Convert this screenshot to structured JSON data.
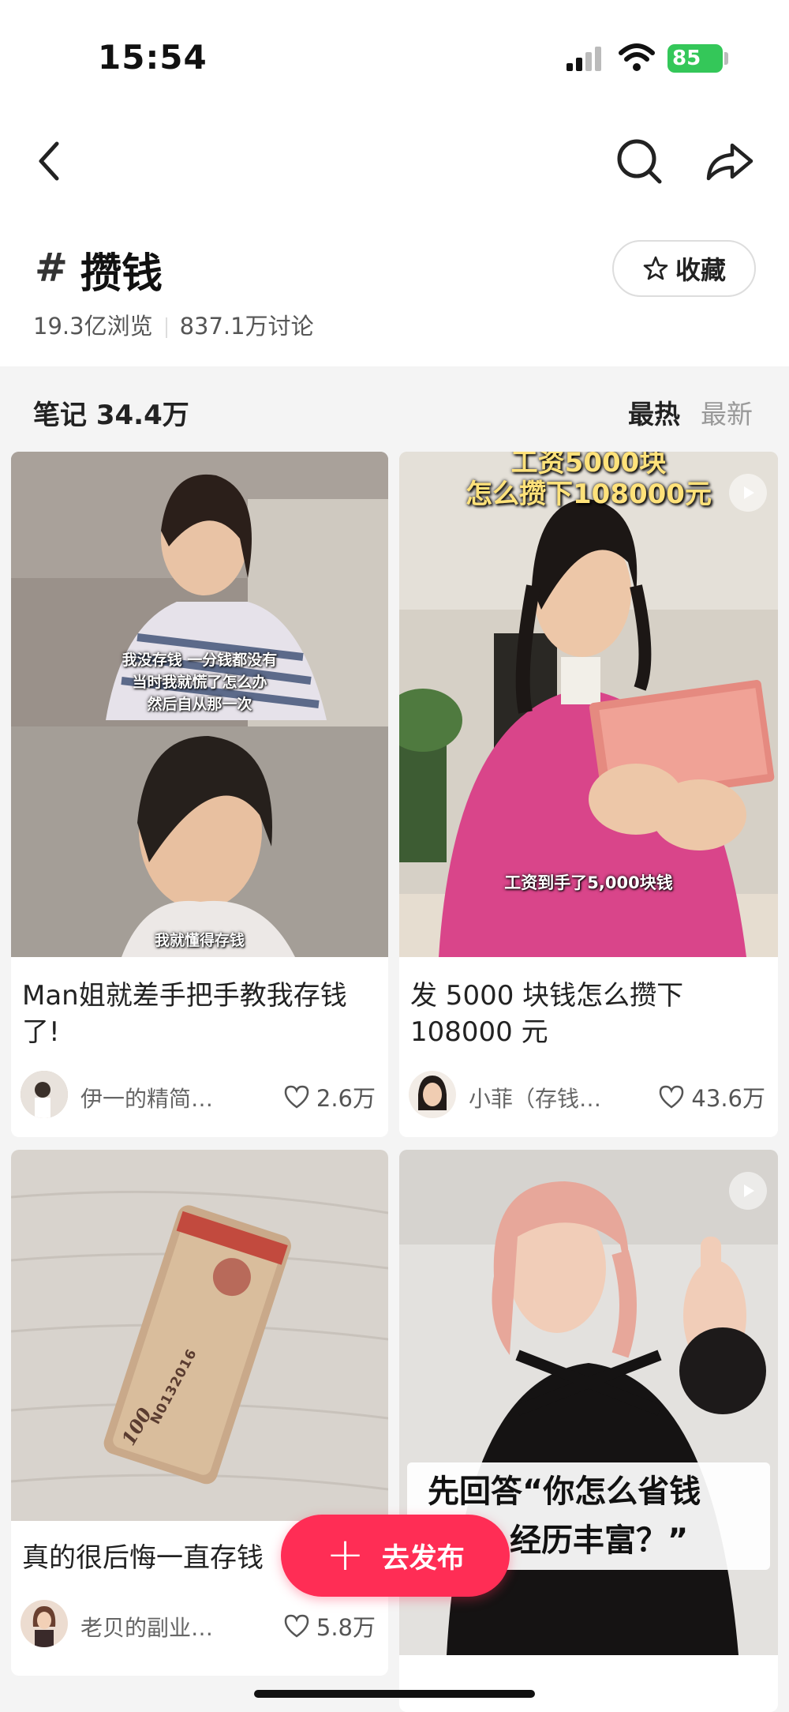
{
  "status_bar": {
    "time": "15:54",
    "battery": "85"
  },
  "topic": {
    "hash": "#",
    "title": "攒钱",
    "views": "19.3亿浏览",
    "discussions": "837.1万讨论",
    "favorite_label": "收藏"
  },
  "notes": {
    "count_label": "笔记 34.4万",
    "sort_hot": "最热",
    "sort_new": "最新"
  },
  "cards": [
    {
      "title": "Man姐就差手把手教我存钱了!",
      "author": "伊一的精简…",
      "likes": "2.6万",
      "subtitle_lines": [
        "我没存钱 一分钱都没有",
        "当时我就慌了怎么办",
        "然后自从那一次"
      ],
      "subtitle_bottom": "我就懂得存钱",
      "is_video": false
    },
    {
      "title": "发 5000 块钱怎么攒下 108000 元",
      "author": "小菲（存钱…",
      "likes": "43.6万",
      "overlay_top_1": "工资5000块",
      "overlay_top_2": "怎么攒下108000元",
      "subtitle_bottom": "工资到手了5,000块钱",
      "is_video": true
    },
    {
      "title": "真的很后悔一直存钱",
      "author": "老贝的副业…",
      "likes": "5.8万",
      "banknote_text": "N0132016",
      "banknote_value": "100",
      "is_video": false
    },
    {
      "overlay_caption_1": "先回答“你怎么省钱",
      "overlay_caption_2": "经历丰富？”",
      "is_video": true
    }
  ],
  "publish_button": {
    "label": "去发布"
  },
  "colors": {
    "accent": "#ff2d55",
    "battery": "#34c759"
  }
}
